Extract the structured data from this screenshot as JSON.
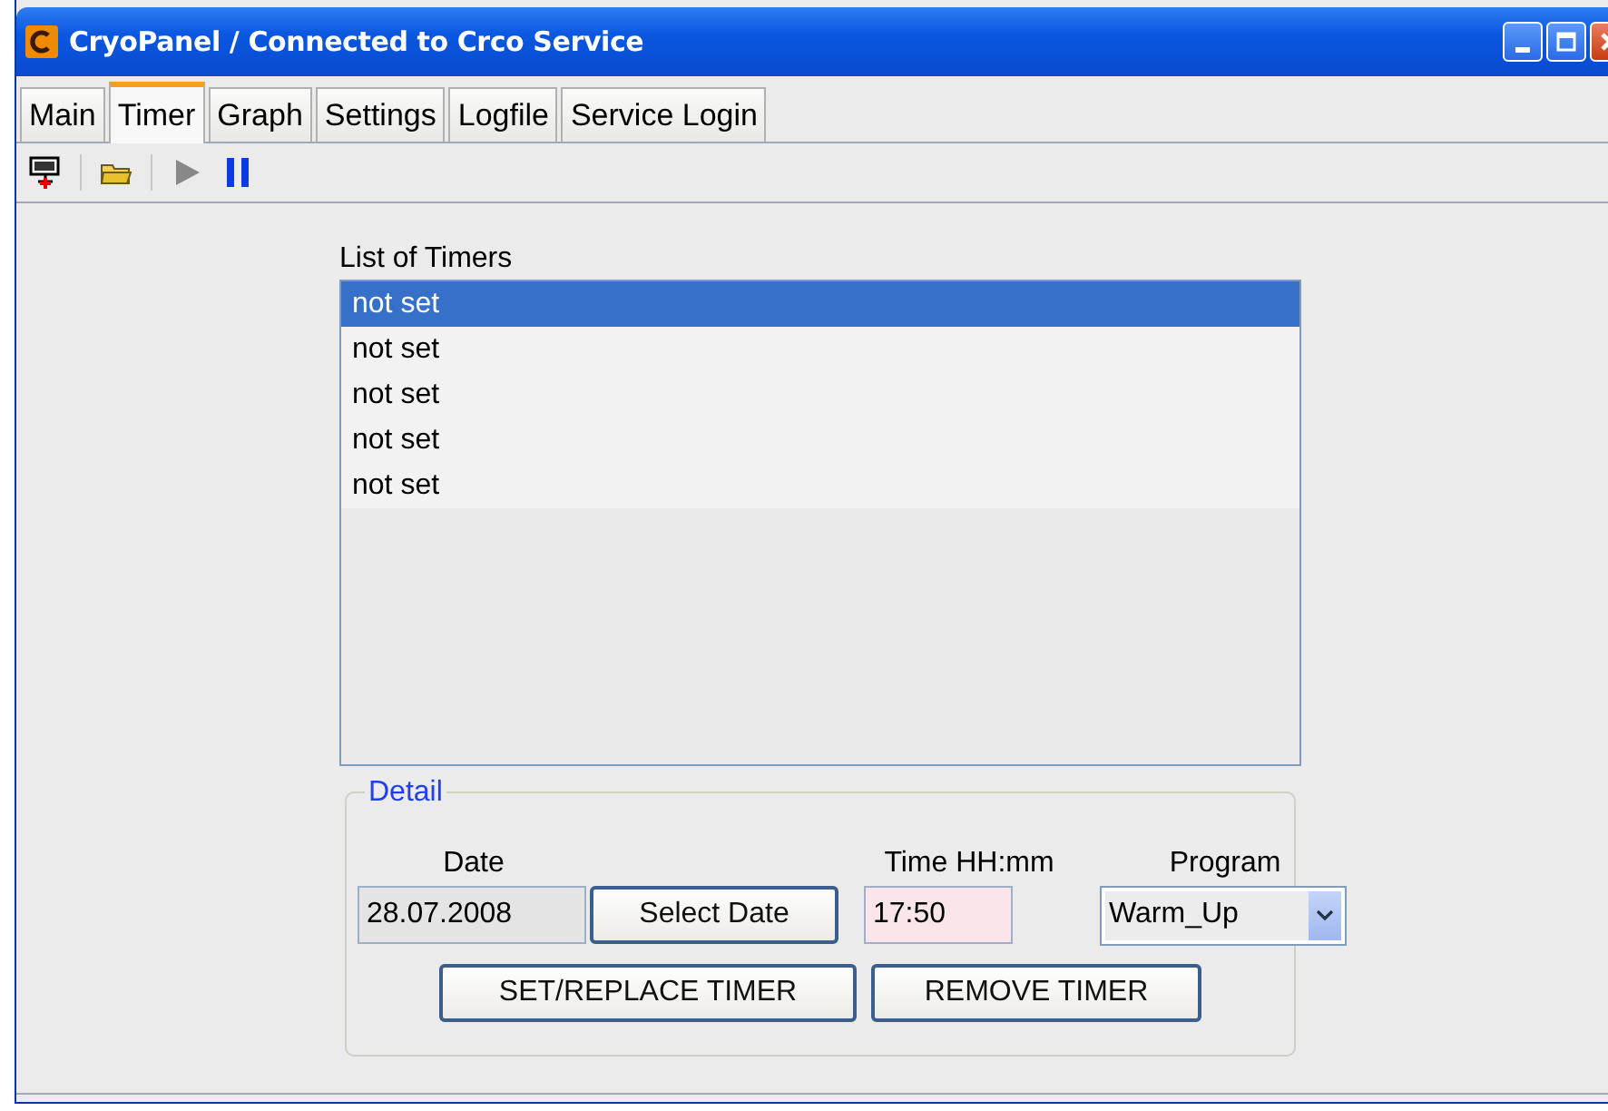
{
  "window": {
    "title": "CryoPanel / Connected to Crco Service"
  },
  "tabs": [
    {
      "label": "Main",
      "selected": false
    },
    {
      "label": "Timer",
      "selected": true
    },
    {
      "label": "Graph",
      "selected": false
    },
    {
      "label": "Settings",
      "selected": false
    },
    {
      "label": "Logfile",
      "selected": false
    },
    {
      "label": "Service Login",
      "selected": false
    }
  ],
  "timer_list": {
    "label": "List of Timers",
    "items": [
      {
        "text": "not set",
        "selected": true
      },
      {
        "text": "not set",
        "selected": false
      },
      {
        "text": "not set",
        "selected": false
      },
      {
        "text": "not set",
        "selected": false
      },
      {
        "text": "not set",
        "selected": false
      }
    ]
  },
  "detail": {
    "legend": "Detail",
    "date_label": "Date",
    "date_value": "28.07.2008",
    "select_date_button": "Select Date",
    "time_label": "Time HH:mm",
    "time_value": "17:50",
    "program_label": "Program",
    "program_value": "Warm_Up",
    "buttons": [
      "SET/REPLACE TIMER",
      "REMOVE TIMER"
    ]
  }
}
